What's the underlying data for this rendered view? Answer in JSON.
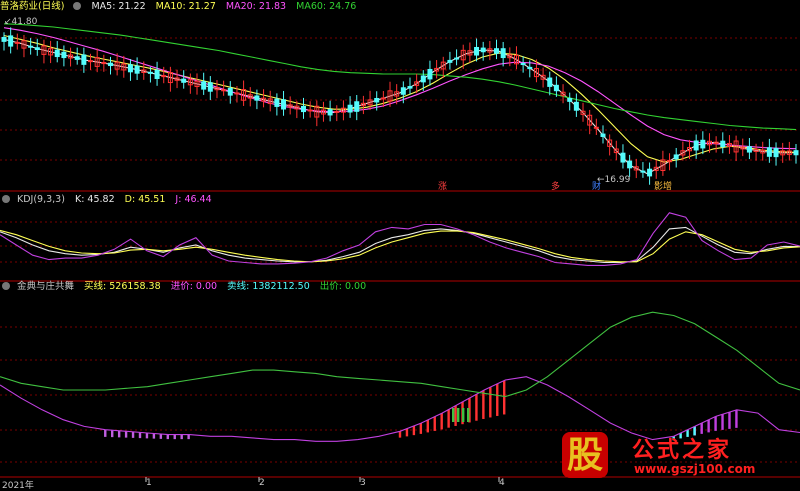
{
  "panels": {
    "price": {
      "stock_name": "普洛药业(日线)",
      "ma5": "MA5: 21.22",
      "ma10": "MA10: 21.27",
      "ma20": "MA20: 21.83",
      "ma60": "MA60: 24.76",
      "high_marker": "41.80",
      "low_marker": "16.99",
      "events": [
        {
          "label": "涨",
          "color": "#ff4040"
        },
        {
          "label": "多",
          "color": "#ff4040"
        },
        {
          "label": "财",
          "color": "#4080ff"
        },
        {
          "label": "影增",
          "color": "#ffc040"
        }
      ]
    },
    "kdj": {
      "title": "KDJ(9,3,3)",
      "k": "K: 45.82",
      "d": "D: 45.51",
      "j": "J: 46.44"
    },
    "jindian": {
      "title": "金典与庄共舞",
      "buy": "买线: 526158.38",
      "enter": "进价: 0.00",
      "sell": "卖线: 1382112.50",
      "exit": "出价: 0.00"
    }
  },
  "time_axis": [
    "2021年",
    "1",
    "2",
    "3",
    "4"
  ],
  "watermark": {
    "glyph": "股",
    "line1": "公式之家",
    "line2": "www.gszj100.com"
  },
  "colors": {
    "up": "#ff3232",
    "down": "#54fcfc",
    "ma5": "#e8e8e8",
    "ma10": "#ffff54",
    "ma20": "#ff54ff",
    "ma60": "#32d232",
    "grid": "#7a0000",
    "frame": "#b00000",
    "purple": "#c040e0",
    "green": "#40c040",
    "buy_bar": "#c060e0"
  },
  "chart_data": [
    {
      "type": "candlestick",
      "series": [
        {
          "name": "MA5",
          "values": [
            38.6,
            38.0,
            37.2,
            36.6,
            36.0,
            35.4,
            35.0,
            34.5,
            34.0,
            33.4,
            32.8,
            32.2,
            31.6,
            31.0,
            30.4,
            29.8,
            29.2,
            28.6,
            28.0,
            27.5,
            27.4,
            28.0,
            28.8,
            29.6,
            30.4,
            31.8,
            33.6,
            35.2,
            36.4,
            37.0,
            36.8,
            35.6,
            34.0,
            32.2,
            30.0,
            27.6,
            24.8,
            21.8,
            19.2,
            18.0,
            19.4,
            21.0,
            22.4,
            22.8,
            22.4,
            21.8,
            21.4,
            21.2,
            21.22
          ]
        },
        {
          "name": "MA10",
          "values": [
            39.2,
            38.6,
            38.0,
            37.3,
            36.7,
            36.1,
            35.6,
            35.1,
            34.6,
            34.1,
            33.5,
            32.9,
            32.3,
            31.7,
            31.1,
            30.5,
            29.9,
            29.3,
            28.7,
            28.2,
            27.9,
            27.9,
            28.2,
            28.8,
            29.6,
            30.6,
            31.9,
            33.4,
            34.8,
            35.9,
            36.5,
            36.3,
            35.5,
            34.2,
            32.4,
            30.2,
            27.8,
            25.2,
            22.6,
            20.6,
            19.8,
            20.2,
            21.0,
            21.8,
            22.2,
            22.0,
            21.6,
            21.4,
            21.27
          ]
        },
        {
          "name": "MA20",
          "values": [
            40.4,
            40.0,
            39.5,
            38.9,
            38.2,
            37.5,
            36.8,
            36.0,
            35.2,
            34.4,
            33.6,
            32.8,
            32.0,
            31.2,
            30.4,
            29.6,
            28.9,
            28.3,
            27.9,
            27.6,
            27.5,
            27.6,
            27.9,
            28.4,
            29.2,
            30.1,
            31.1,
            32.2,
            33.2,
            34.1,
            34.8,
            35.1,
            35.0,
            34.5,
            33.5,
            32.2,
            30.6,
            28.8,
            27.0,
            25.3,
            24.0,
            23.2,
            22.8,
            22.6,
            22.4,
            22.2,
            22.0,
            21.9,
            21.83
          ]
        },
        {
          "name": "MA60",
          "values": [
            41.0,
            40.9,
            40.7,
            40.5,
            40.2,
            39.9,
            39.6,
            39.3,
            38.9,
            38.5,
            38.1,
            37.7,
            37.3,
            36.9,
            36.4,
            35.9,
            35.4,
            34.9,
            34.4,
            34.0,
            33.7,
            33.5,
            33.4,
            33.3,
            33.3,
            33.3,
            33.2,
            33.0,
            32.8,
            32.5,
            32.1,
            31.6,
            31.0,
            30.4,
            29.8,
            29.2,
            28.6,
            28.0,
            27.5,
            27.0,
            26.6,
            26.3,
            26.0,
            25.7,
            25.4,
            25.2,
            25.0,
            24.9,
            24.76
          ]
        }
      ],
      "high": 41.8,
      "low": 16.99,
      "ylim": [
        15.5,
        42.5
      ]
    },
    {
      "type": "line",
      "title": "KDJ(9,3,3)",
      "series": [
        {
          "name": "K",
          "values": [
            66,
            58,
            48,
            40,
            36,
            34,
            35,
            38,
            45,
            42,
            38,
            44,
            48,
            40,
            34,
            30,
            28,
            26,
            25,
            25,
            27,
            32,
            38,
            50,
            58,
            62,
            68,
            70,
            68,
            64,
            58,
            52,
            46,
            40,
            32,
            28,
            26,
            24,
            24,
            26,
            45,
            70,
            72,
            60,
            48,
            38,
            36,
            42,
            46,
            45.82
          ]
        },
        {
          "name": "D",
          "values": [
            68,
            62,
            54,
            46,
            40,
            37,
            36,
            37,
            41,
            42,
            40,
            42,
            45,
            42,
            38,
            34,
            31,
            28,
            26,
            25,
            26,
            29,
            34,
            44,
            52,
            58,
            64,
            67,
            67,
            65,
            60,
            55,
            49,
            43,
            36,
            31,
            28,
            26,
            25,
            25,
            36,
            56,
            66,
            62,
            52,
            42,
            38,
            40,
            44,
            45.51
          ]
        },
        {
          "name": "J",
          "values": [
            62,
            48,
            34,
            28,
            30,
            30,
            34,
            42,
            56,
            40,
            32,
            48,
            58,
            34,
            26,
            24,
            22,
            22,
            23,
            25,
            30,
            40,
            48,
            66,
            72,
            70,
            76,
            76,
            70,
            62,
            52,
            44,
            38,
            32,
            24,
            22,
            20,
            20,
            22,
            28,
            64,
            92,
            86,
            54,
            40,
            28,
            30,
            48,
            52,
            46.44
          ]
        }
      ],
      "ylim": [
        0,
        100
      ]
    },
    {
      "type": "line",
      "title": "金典与庄共舞",
      "series": [
        {
          "name": "买线",
          "values": [
            55,
            47,
            40,
            34,
            30,
            28,
            27,
            26,
            25,
            25,
            24,
            24,
            23,
            22,
            22,
            21,
            21,
            22,
            24,
            27,
            32,
            38,
            45,
            52,
            58,
            60,
            55,
            48,
            40,
            32,
            26,
            22,
            24,
            30,
            36,
            40,
            38,
            28,
            26.3
          ]
        },
        {
          "name": "卖线",
          "values": [
            60,
            56,
            54,
            52,
            52,
            52,
            53,
            54,
            56,
            58,
            60,
            62,
            64,
            64,
            63,
            62,
            60,
            59,
            58,
            57,
            56,
            54,
            52,
            50,
            48,
            52,
            60,
            70,
            80,
            90,
            96,
            99,
            97,
            92,
            84,
            76,
            66,
            56,
            52
          ]
        }
      ],
      "ylim": [
        0,
        110
      ]
    }
  ]
}
